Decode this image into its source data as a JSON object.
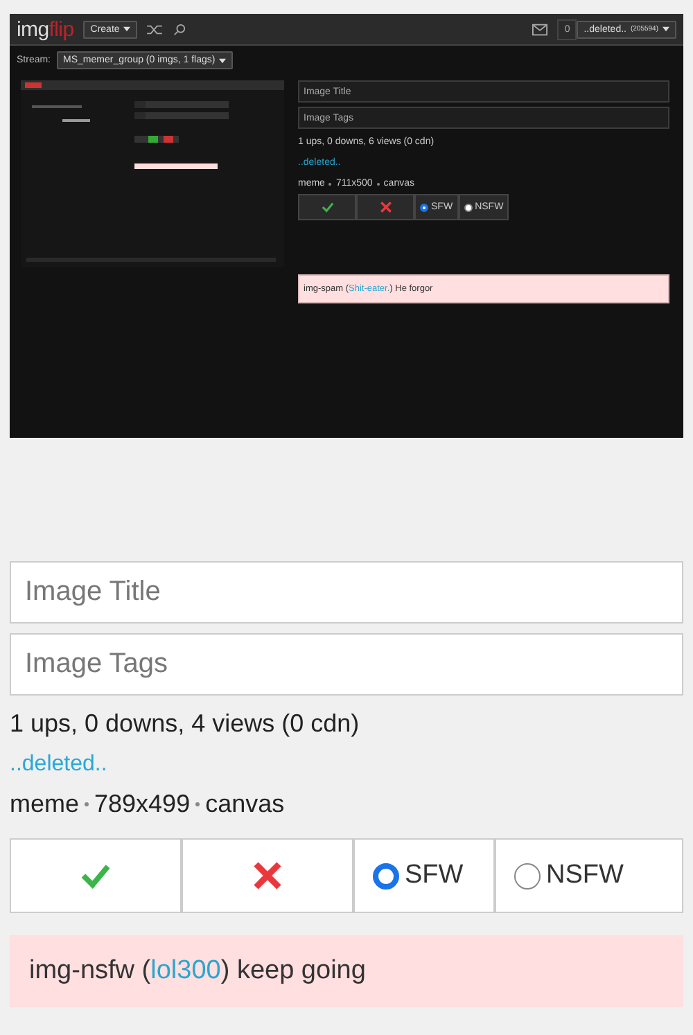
{
  "embedded_screenshot": {
    "header": {
      "logo": [
        "img",
        "flip"
      ],
      "create_button": "Create",
      "notification_count": "0",
      "user_menu": "..deleted..",
      "user_points": "(205594)"
    },
    "stream": {
      "label": "Stream:",
      "dropdown": "MS_memer_group (0 imgs, 1 flags)"
    },
    "title_field": {
      "placeholder": "Image Title"
    },
    "tags_field": {
      "placeholder": "Image Tags"
    },
    "stats": "1 ups, 0 downs, 6 views (0 cdn)",
    "author": "..deleted..",
    "meta": [
      "meme",
      "711x500",
      "canvas"
    ],
    "actions": [
      {
        "kind": "approve"
      },
      {
        "kind": "reject"
      }
    ],
    "rating": [
      {
        "label": "SFW",
        "selected": true
      },
      {
        "label": "NSFW",
        "selected": false
      }
    ],
    "flag": {
      "before": "img-spam (",
      "user": "Shit-eater.",
      "after": ") He forgor"
    }
  },
  "main": {
    "title_field": {
      "placeholder": "Image Title"
    },
    "tags_field": {
      "placeholder": "Image Tags"
    },
    "stats": "1 ups, 0 downs, 4 views (0 cdn)",
    "author": "..deleted..",
    "meta": [
      "meme",
      "789x499",
      "canvas"
    ],
    "actions": [
      {
        "kind": "approve"
      },
      {
        "kind": "reject"
      }
    ],
    "rating": [
      {
        "label": "SFW",
        "selected": true
      },
      {
        "label": "NSFW",
        "selected": false
      }
    ],
    "flag": {
      "before": "img-nsfw (",
      "user": "lol300",
      "after": ") keep going"
    }
  }
}
